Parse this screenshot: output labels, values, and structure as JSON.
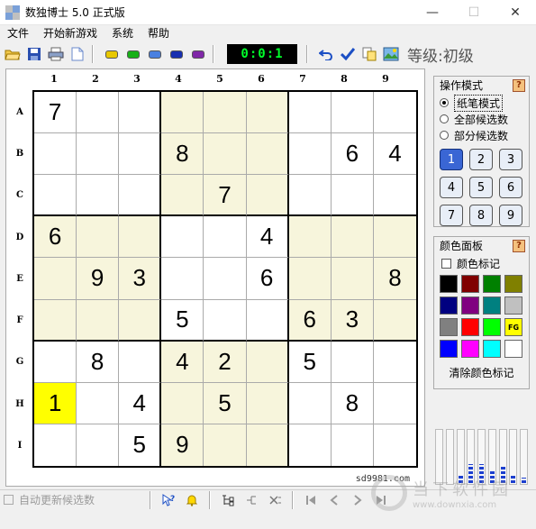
{
  "window": {
    "title": "数独博士 5.0 正式版",
    "minimize": "—",
    "maximize": "☐",
    "close": "✕"
  },
  "menu": [
    "文件",
    "开始新游戏",
    "系统",
    "帮助"
  ],
  "toolbar": {
    "timer": "0:0:1",
    "level": "等级:初级",
    "color_pills": [
      "#e8c800",
      "#18b018",
      "#4a80e0",
      "#1830b0",
      "#8028a8"
    ]
  },
  "board": {
    "col_labels": [
      "1",
      "2",
      "3",
      "4",
      "5",
      "6",
      "7",
      "8",
      "9"
    ],
    "row_labels": [
      "A",
      "B",
      "C",
      "D",
      "E",
      "F",
      "G",
      "H",
      "I"
    ],
    "cells": [
      [
        "7",
        "",
        "",
        "",
        "",
        "",
        "",
        "",
        ""
      ],
      [
        "",
        "",
        "",
        "8",
        "",
        "",
        "",
        "6",
        "4"
      ],
      [
        "",
        "",
        "",
        "",
        "7",
        "",
        "",
        "",
        ""
      ],
      [
        "6",
        "",
        "",
        "",
        "",
        "4",
        "",
        "",
        ""
      ],
      [
        "",
        "9",
        "3",
        "",
        "",
        "6",
        "",
        "",
        "8"
      ],
      [
        "",
        "",
        "",
        "5",
        "",
        "",
        "6",
        "3",
        ""
      ],
      [
        "",
        "8",
        "",
        "4",
        "2",
        "",
        "5",
        "",
        ""
      ],
      [
        "1",
        "",
        "4",
        "",
        "5",
        "",
        "",
        "8",
        ""
      ],
      [
        "",
        "",
        "5",
        "9",
        "",
        "",
        "",
        "",
        ""
      ]
    ],
    "highlight": {
      "row": 7,
      "col": 0,
      "color": "#ffff00"
    },
    "shade_color": "#f7f5dc",
    "watermark": "sd9981.com"
  },
  "mode_panel": {
    "title": "操作模式",
    "help": "?",
    "options": [
      "纸笔模式",
      "全部候选数",
      "部分候选数"
    ],
    "selected": 0,
    "numbers": [
      "1",
      "2",
      "3",
      "4",
      "5",
      "6",
      "7",
      "8",
      "9"
    ],
    "active_number": 0
  },
  "color_panel": {
    "title": "颜色面板",
    "help": "?",
    "mark_label": "颜色标记",
    "swatches": [
      "#000000",
      "#800000",
      "#008000",
      "#808000",
      "#000080",
      "#800080",
      "#008080",
      "#c0c0c0",
      "#808080",
      "#ff0000",
      "#00ff00",
      "#ffff00",
      "#0000ff",
      "#ff00ff",
      "#00ffff",
      "#ffffff"
    ],
    "fg_swatch_label": "FG",
    "clear_label": "清除颜色标记"
  },
  "meter_levels": [
    0,
    0,
    0.15,
    0.35,
    0.35,
    0.25,
    0.3,
    0.15,
    0.1
  ],
  "status": {
    "auto_update_label": "自动更新候选数"
  },
  "brand": {
    "name": "当下软件园",
    "url": "www.downxia.com"
  }
}
